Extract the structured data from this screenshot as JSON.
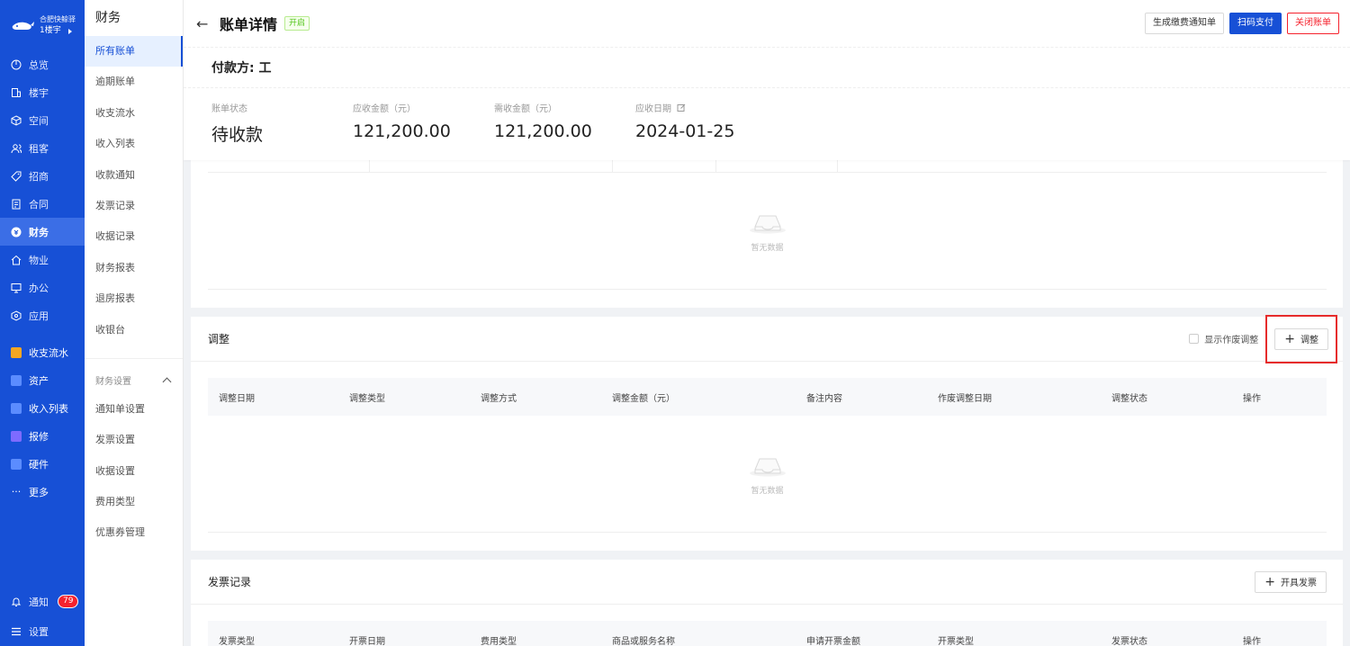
{
  "brand": {
    "name": "合肥快鲸驿",
    "floor": "1楼宇"
  },
  "nav1": [
    {
      "label": "总览",
      "icon": "dashboard-icon"
    },
    {
      "label": "楼宇",
      "icon": "building-icon"
    },
    {
      "label": "空间",
      "icon": "cube-icon"
    },
    {
      "label": "租客",
      "icon": "users-icon"
    },
    {
      "label": "招商",
      "icon": "tag-icon"
    },
    {
      "label": "合同",
      "icon": "document-icon"
    },
    {
      "label": "财务",
      "icon": "finance-icon"
    },
    {
      "label": "物业",
      "icon": "home-icon"
    },
    {
      "label": "办公",
      "icon": "monitor-icon"
    },
    {
      "label": "应用",
      "icon": "app-icon"
    }
  ],
  "nav1_apps": [
    {
      "label": "收支流水",
      "color": "#f5a623"
    },
    {
      "label": "资产",
      "color": "#5b8cff"
    },
    {
      "label": "收入列表",
      "color": "#5b8cff"
    },
    {
      "label": "报修",
      "color": "#7e6bff"
    },
    {
      "label": "硬件",
      "color": "#5b8cff"
    }
  ],
  "nav1_more": "更多",
  "nav1_bottom": {
    "notify": "通知",
    "notify_count": "79",
    "settings": "设置"
  },
  "nav2": {
    "title": "财务",
    "items": [
      "所有账单",
      "逾期账单",
      "收支流水",
      "收入列表",
      "收款通知",
      "发票记录",
      "收据记录",
      "财务报表",
      "退房报表",
      "收银台"
    ],
    "group": "财务设置",
    "group_items": [
      "通知单设置",
      "发票设置",
      "收据设置",
      "费用类型",
      "优惠券管理"
    ]
  },
  "header": {
    "title": "账单详情",
    "tag": "开启",
    "buttons": {
      "notice": "生成缴费通知单",
      "scan": "扫码支付",
      "close": "关闭账单"
    },
    "payer": "付款方: 工",
    "stats": [
      {
        "label": "账单状态",
        "value": "待收款"
      },
      {
        "label": "应收金额（元）",
        "value": "121,200.00"
      },
      {
        "label": "需收金额（元）",
        "value": "121,200.00"
      },
      {
        "label": "应收日期",
        "value": "2024-01-25"
      }
    ]
  },
  "empty_text": "暂无数据",
  "adjust": {
    "title": "调整",
    "checkbox_label": "显示作废调整",
    "add_button": "调整",
    "columns": [
      "调整日期",
      "调整类型",
      "调整方式",
      "调整金额（元）",
      "备注内容",
      "作废调整日期",
      "调整状态",
      "操作"
    ]
  },
  "invoice": {
    "title": "发票记录",
    "add_button": "开具发票",
    "columns": [
      "发票类型",
      "开票日期",
      "费用类型",
      "商品或服务名称",
      "申请开票金额",
      "开票类型",
      "发票状态",
      "操作"
    ]
  }
}
